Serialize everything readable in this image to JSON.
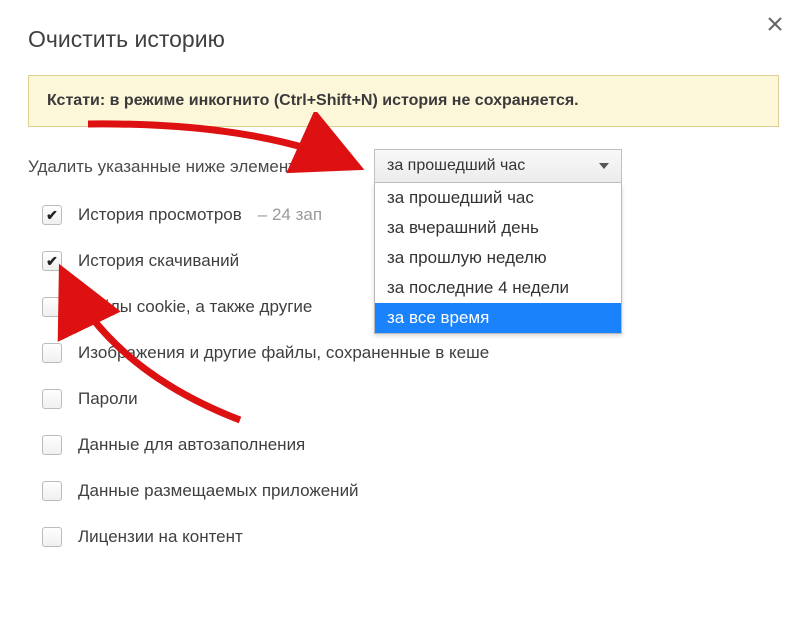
{
  "dialog": {
    "title": "Очистить историю",
    "banner": "Кстати: в режиме инкогнито (Ctrl+Shift+N) история не сохраняется.",
    "prompt": "Удалить указанные ниже элементы"
  },
  "time_select": {
    "selected": "за прошедший час",
    "options": [
      {
        "label": "за прошедший час",
        "highlighted": false
      },
      {
        "label": "за вчерашний день",
        "highlighted": false
      },
      {
        "label": "за прошлую неделю",
        "highlighted": false
      },
      {
        "label": "за последние 4 недели",
        "highlighted": false
      },
      {
        "label": "за все время",
        "highlighted": true
      }
    ]
  },
  "checkboxes": [
    {
      "label": "История просмотров",
      "suffix": "–  24 зап",
      "checked": true
    },
    {
      "label": "История скачиваний",
      "suffix": "",
      "checked": true
    },
    {
      "label": "Файлы cookie, а также другие",
      "suffix": "",
      "checked": false
    },
    {
      "label": "Изображения и другие файлы, сохраненные в кеше",
      "suffix": "",
      "checked": false
    },
    {
      "label": "Пароли",
      "suffix": "",
      "checked": false
    },
    {
      "label": "Данные для автозаполнения",
      "suffix": "",
      "checked": false
    },
    {
      "label": "Данные размещаемых приложений",
      "suffix": "",
      "checked": false
    },
    {
      "label": "Лицензии на контент",
      "suffix": "",
      "checked": false
    }
  ]
}
